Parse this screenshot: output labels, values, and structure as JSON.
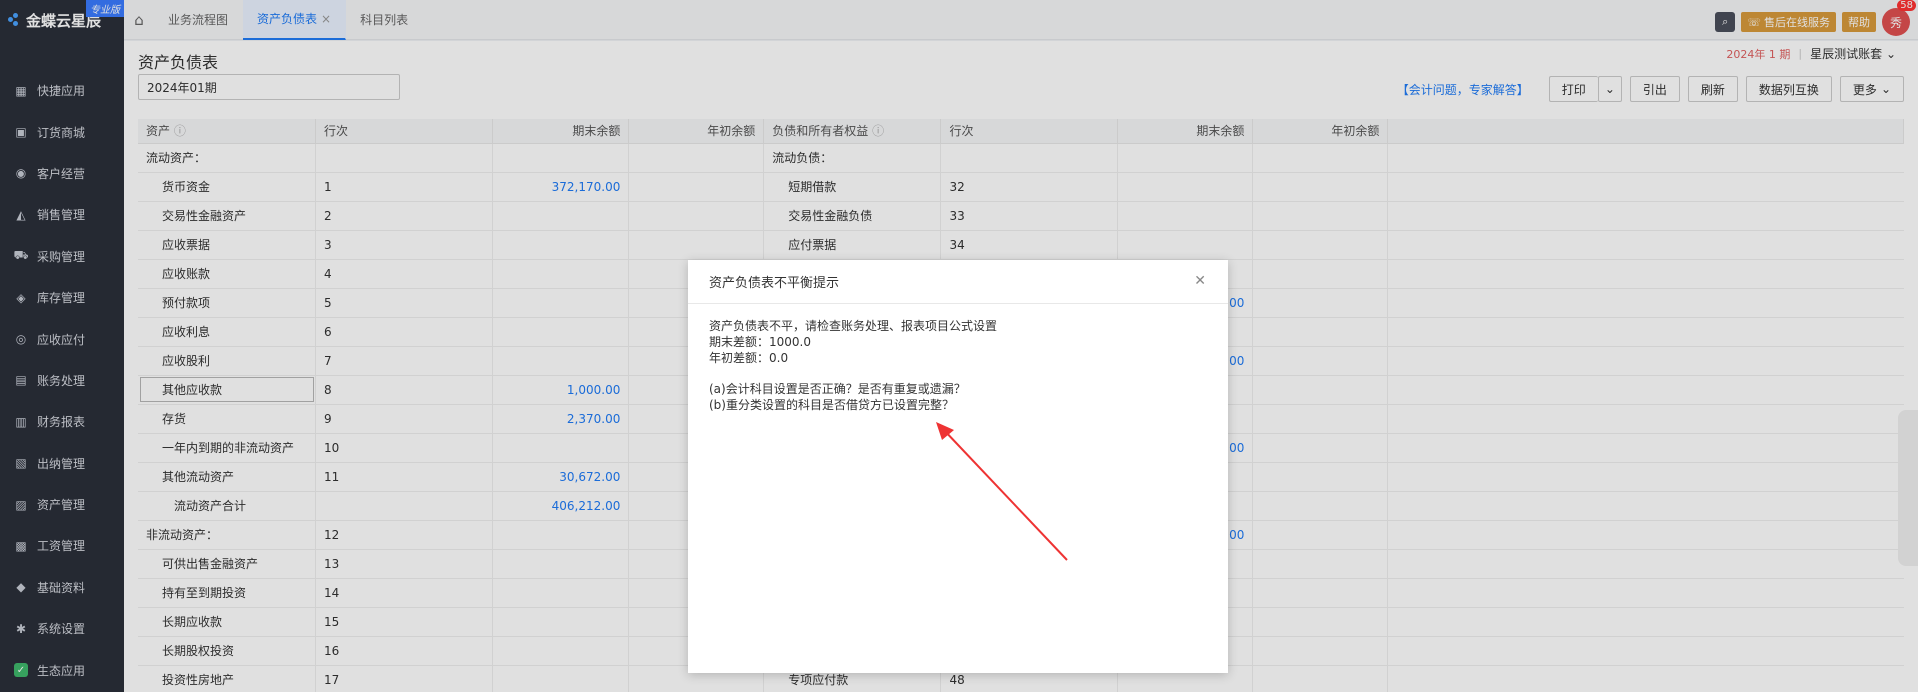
{
  "app": {
    "logo_text": "金蝶云星辰",
    "edition": "专业版"
  },
  "sidebar": {
    "items": [
      {
        "label": "快捷应用",
        "icon": "grid-icon",
        "glyph": "▦"
      },
      {
        "label": "订货商城",
        "icon": "bag-icon",
        "glyph": "▣"
      },
      {
        "label": "客户经营",
        "icon": "user-icon",
        "glyph": "◉"
      },
      {
        "label": "销售管理",
        "icon": "chart-icon",
        "glyph": "◭"
      },
      {
        "label": "采购管理",
        "icon": "cart-icon",
        "glyph": "⛟"
      },
      {
        "label": "库存管理",
        "icon": "box-icon",
        "glyph": "◈"
      },
      {
        "label": "应收应付",
        "icon": "coin-icon",
        "glyph": "◎"
      },
      {
        "label": "账务处理",
        "icon": "wallet-icon",
        "glyph": "▤"
      },
      {
        "label": "财务报表",
        "icon": "report-icon",
        "glyph": "▥"
      },
      {
        "label": "出纳管理",
        "icon": "cashier-icon",
        "glyph": "▧"
      },
      {
        "label": "资产管理",
        "icon": "asset-icon",
        "glyph": "▨"
      },
      {
        "label": "工资管理",
        "icon": "salary-icon",
        "glyph": "▩"
      },
      {
        "label": "基础资料",
        "icon": "layers-icon",
        "glyph": "◆"
      },
      {
        "label": "系统设置",
        "icon": "gear-icon",
        "glyph": "✱"
      },
      {
        "label": "生态应用",
        "icon": "check-icon",
        "glyph": "✓"
      }
    ]
  },
  "topbar": {
    "tabs": [
      {
        "label": "业务流程图",
        "active": false,
        "closable": false
      },
      {
        "label": "资产负债表",
        "active": true,
        "closable": true
      },
      {
        "label": "科目列表",
        "active": false,
        "closable": false
      }
    ],
    "service_label": "售后在线服务",
    "help_label": "帮助",
    "avatar_text": "秀",
    "badge_count": "58"
  },
  "page": {
    "title": "资产负债表",
    "period": "2024年01期",
    "year_text": "2024年",
    "period_no": "1",
    "period_unit": "期",
    "account_set": "星辰测试账套",
    "expert_link": "【会计问题，专家解答】",
    "buttons": {
      "print": "打印",
      "export": "引出",
      "refresh": "刷新",
      "swap": "数据列互换",
      "more": "更多"
    }
  },
  "table": {
    "headers": [
      "资产",
      "行次",
      "期末余额",
      "年初余额",
      "负债和所有者权益",
      "行次",
      "期末余额",
      "年初余额"
    ],
    "rows": [
      {
        "a": "流动资产：",
        "al": "",
        "ae": "",
        "ab": "",
        "l": "流动负债：",
        "ll": "",
        "le": "",
        "lb": "",
        "aind": 0,
        "lind": 0
      },
      {
        "a": "货币资金",
        "al": "1",
        "ae": "372,170.00",
        "ab": "",
        "l": "短期借款",
        "ll": "32",
        "le": "",
        "lb": "",
        "aind": 1,
        "lind": 1
      },
      {
        "a": "交易性金融资产",
        "al": "2",
        "ae": "",
        "ab": "",
        "l": "交易性金融负债",
        "ll": "33",
        "le": "",
        "lb": "",
        "aind": 1,
        "lind": 1
      },
      {
        "a": "应收票据",
        "al": "3",
        "ae": "",
        "ab": "",
        "l": "应付票据",
        "ll": "34",
        "le": "",
        "lb": "",
        "aind": 1,
        "lind": 1
      },
      {
        "a": "应收账款",
        "al": "4",
        "ae": "",
        "ab": "",
        "l": "",
        "ll": "",
        "le": "",
        "lb": "",
        "aind": 1,
        "lind": 1
      },
      {
        "a": "预付款项",
        "al": "5",
        "ae": "",
        "ab": "",
        "l": "",
        "ll": "",
        "le": ".00",
        "lb": "",
        "aind": 1,
        "lind": 1
      },
      {
        "a": "应收利息",
        "al": "6",
        "ae": "",
        "ab": "",
        "l": "",
        "ll": "",
        "le": "",
        "lb": "",
        "aind": 1,
        "lind": 1
      },
      {
        "a": "应收股利",
        "al": "7",
        "ae": "",
        "ab": "",
        "l": "",
        "ll": "",
        "le": ".00",
        "lb": "",
        "aind": 1,
        "lind": 1
      },
      {
        "a": "其他应收款",
        "al": "8",
        "ae": "1,000.00",
        "ab": "",
        "l": "",
        "ll": "",
        "le": "",
        "lb": "",
        "aind": 1,
        "lind": 1,
        "selected": true
      },
      {
        "a": "存货",
        "al": "9",
        "ae": "2,370.00",
        "ab": "",
        "l": "",
        "ll": "",
        "le": "",
        "lb": "",
        "aind": 1,
        "lind": 1
      },
      {
        "a": "一年内到期的非流动资产",
        "al": "10",
        "ae": "",
        "ab": "",
        "l": "",
        "ll": "",
        "le": ".00",
        "lb": "",
        "aind": 1,
        "lind": 1
      },
      {
        "a": "其他流动资产",
        "al": "11",
        "ae": "30,672.00",
        "ab": "",
        "l": "",
        "ll": "",
        "le": "",
        "lb": "",
        "aind": 1,
        "lind": 1
      },
      {
        "a": "流动资产合计",
        "al": "",
        "ae": "406,212.00",
        "ab": "",
        "l": "",
        "ll": "",
        "le": "",
        "lb": "",
        "aind": 2,
        "lind": 1
      },
      {
        "a": "非流动资产：",
        "al": "12",
        "ae": "",
        "ab": "",
        "l": "",
        "ll": "",
        "le": ".00",
        "lb": "",
        "aind": 0,
        "lind": 1
      },
      {
        "a": "可供出售金融资产",
        "al": "13",
        "ae": "",
        "ab": "",
        "l": "",
        "ll": "",
        "le": "",
        "lb": "",
        "aind": 1,
        "lind": 1
      },
      {
        "a": "持有至到期投资",
        "al": "14",
        "ae": "",
        "ab": "",
        "l": "",
        "ll": "",
        "le": "",
        "lb": "",
        "aind": 1,
        "lind": 1
      },
      {
        "a": "长期应收款",
        "al": "15",
        "ae": "",
        "ab": "",
        "l": "",
        "ll": "",
        "le": "",
        "lb": "",
        "aind": 1,
        "lind": 1
      },
      {
        "a": "长期股权投资",
        "al": "16",
        "ae": "",
        "ab": "",
        "l": "",
        "ll": "",
        "le": "",
        "lb": "",
        "aind": 1,
        "lind": 1
      },
      {
        "a": "投资性房地产",
        "al": "17",
        "ae": "",
        "ab": "",
        "l": "专项应付款",
        "ll": "48",
        "le": "",
        "lb": "",
        "aind": 1,
        "lind": 1
      }
    ]
  },
  "modal": {
    "title": "资产负债表不平衡提示",
    "line1": "资产负债表不平，请检查账务处理、报表项目公式设置",
    "line2": "期末差额：1000.0",
    "line3": "年初差额：0.0",
    "line4": "(a)会计科目设置是否正确？是否有重复或遗漏？",
    "line5": "(b)重分类设置的科目是否借贷方已设置完整？"
  }
}
